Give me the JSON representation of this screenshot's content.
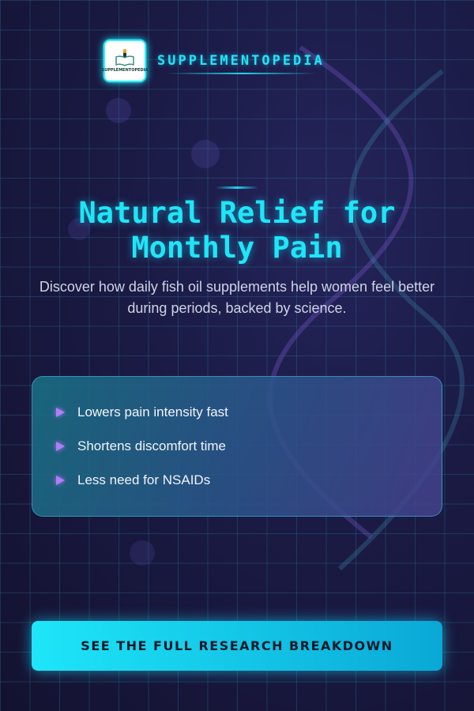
{
  "brand": {
    "name": "SUPPLEMENTOPEDIA",
    "logo_text": "SUPPLEMENTOPEDIA"
  },
  "hero": {
    "title_line1": "Natural Relief for",
    "title_line2": "Monthly Pain",
    "subtitle": "Discover how daily fish oil supplements help women feel better during periods, backed by science."
  },
  "benefits": [
    {
      "label": "Lowers pain intensity fast"
    },
    {
      "label": "Shortens discomfort time"
    },
    {
      "label": "Less need for NSAIDs"
    }
  ],
  "cta": {
    "label": "SEE THE FULL RESEARCH BREAKDOWN"
  },
  "colors": {
    "accent": "#1ee6f7",
    "bullet": "#b27cf7",
    "background": "#1a1a44"
  }
}
